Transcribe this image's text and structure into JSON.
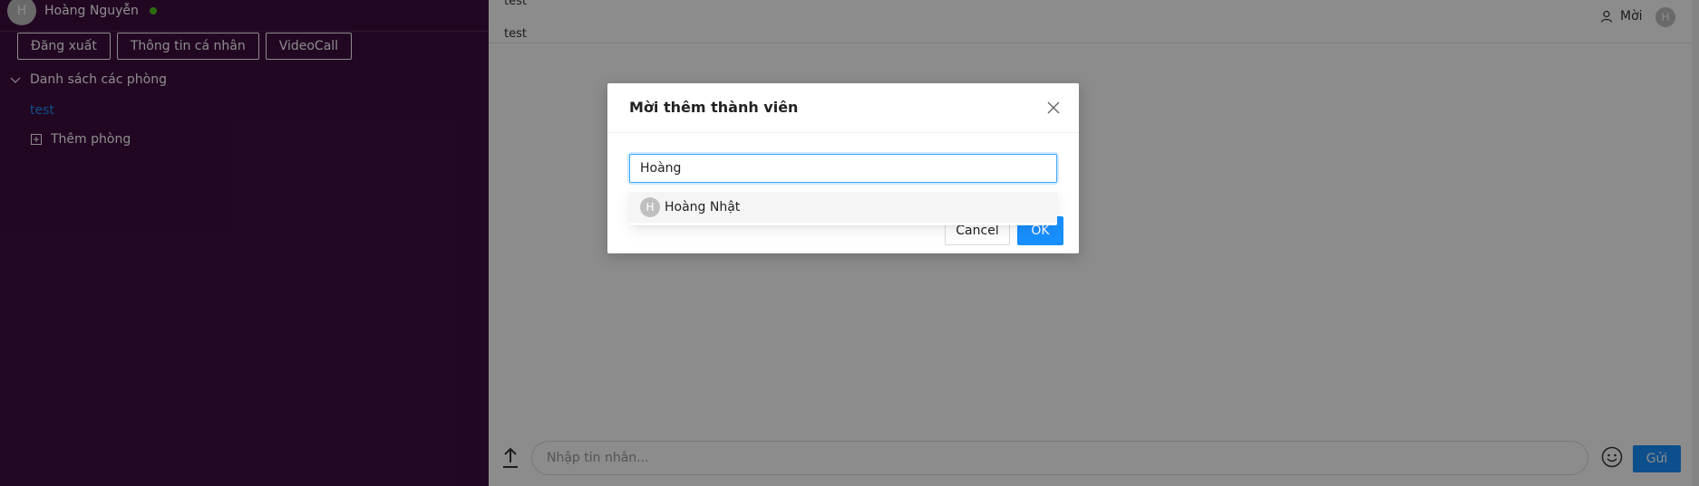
{
  "sidebar": {
    "user": {
      "avatar_initial": "H",
      "name": "Hoàng Nguyễn",
      "status_color": "#52c41a"
    },
    "buttons": {
      "logout": "Đăng xuất",
      "profile": "Thông tin cá nhân",
      "video_call": "VideoCall"
    },
    "rooms_header": "Danh sách các phòng",
    "rooms": [
      {
        "name": "test"
      }
    ],
    "add_room": "Thêm phòng"
  },
  "main": {
    "messages": [
      {
        "text": "test"
      },
      {
        "text": "test"
      }
    ],
    "header": {
      "invite_label": "Mời",
      "avatar_initial": "H"
    },
    "composer": {
      "placeholder": "Nhập tin nhắn...",
      "send_label": "Gửi"
    }
  },
  "modal": {
    "title": "Mời thêm thành viên",
    "search_value": "Hoàng",
    "options": [
      {
        "avatar_initial": "H",
        "label": "Hoàng Nhật"
      }
    ],
    "cancel_label": "Cancel",
    "ok_label": "OK"
  },
  "colors": {
    "sidebar_bg": "#3f0e40",
    "primary": "#1890ff",
    "online": "#52c41a"
  }
}
